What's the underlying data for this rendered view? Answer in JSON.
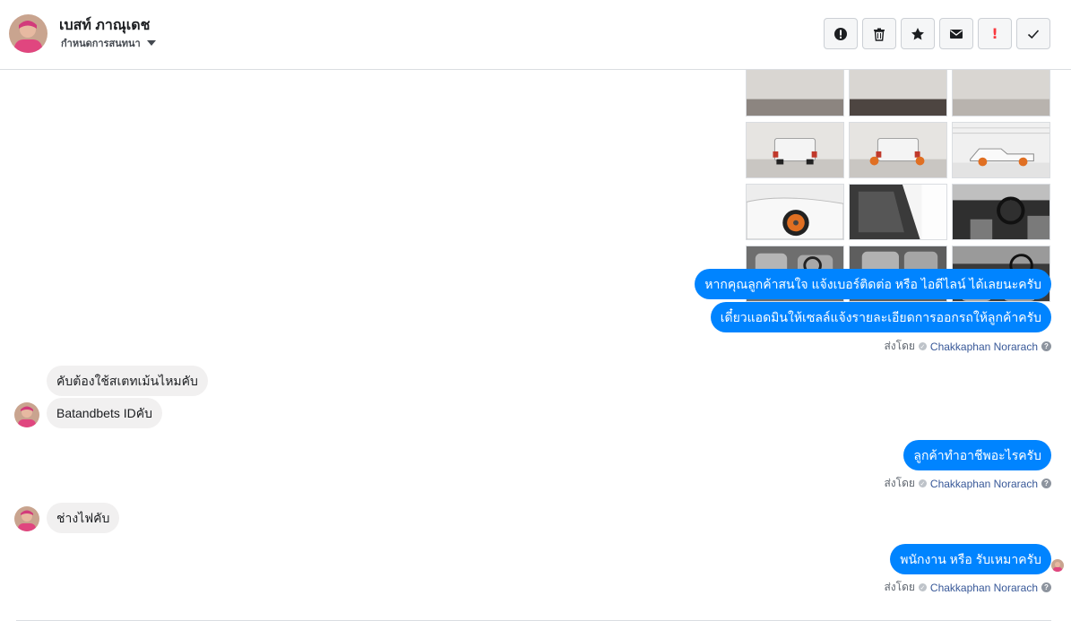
{
  "header": {
    "name": "เบสท์ ภาณุเดช",
    "sub_label": "กำหนดการสนทนา",
    "tools": [
      {
        "name": "alert-circle-icon",
        "label": "Report"
      },
      {
        "name": "trash-icon",
        "label": "Delete"
      },
      {
        "name": "star-icon",
        "label": "Star"
      },
      {
        "name": "envelope-icon",
        "label": "Mark unread"
      },
      {
        "name": "spam-icon",
        "label": "!"
      },
      {
        "name": "check-icon",
        "label": "Done"
      }
    ]
  },
  "photos": {
    "count": 12,
    "rows": 4,
    "cols": 3
  },
  "messages": {
    "out1": "หากคุณลูกค้าสนใจ แจ้งเบอร์ติดต่อ หรือ ไอดีไลน์ ได้เลยนะครับ",
    "out2": "เดี๋ยวแอดมินให้เซลล์แจ้งรายละเอียดการออกรถให้ลูกค้าครับ",
    "in1": "คับต้องใช้สเตทเม้นไหมคับ",
    "in2": "Batandbets IDคับ",
    "out3": "ลูกค้าทำอาชีพอะไรครับ",
    "in3": "ช่างไฟคับ",
    "out4": "พนักงาน หรือ รับเหมาครับ"
  },
  "sent_by": {
    "prefix": "ส่งโดย",
    "agent": "Chakkaphan Norarach",
    "help": "?"
  },
  "colors": {
    "outgoing": "#0084ff",
    "incoming": "#f1f0f0",
    "agent_link": "#385898"
  }
}
